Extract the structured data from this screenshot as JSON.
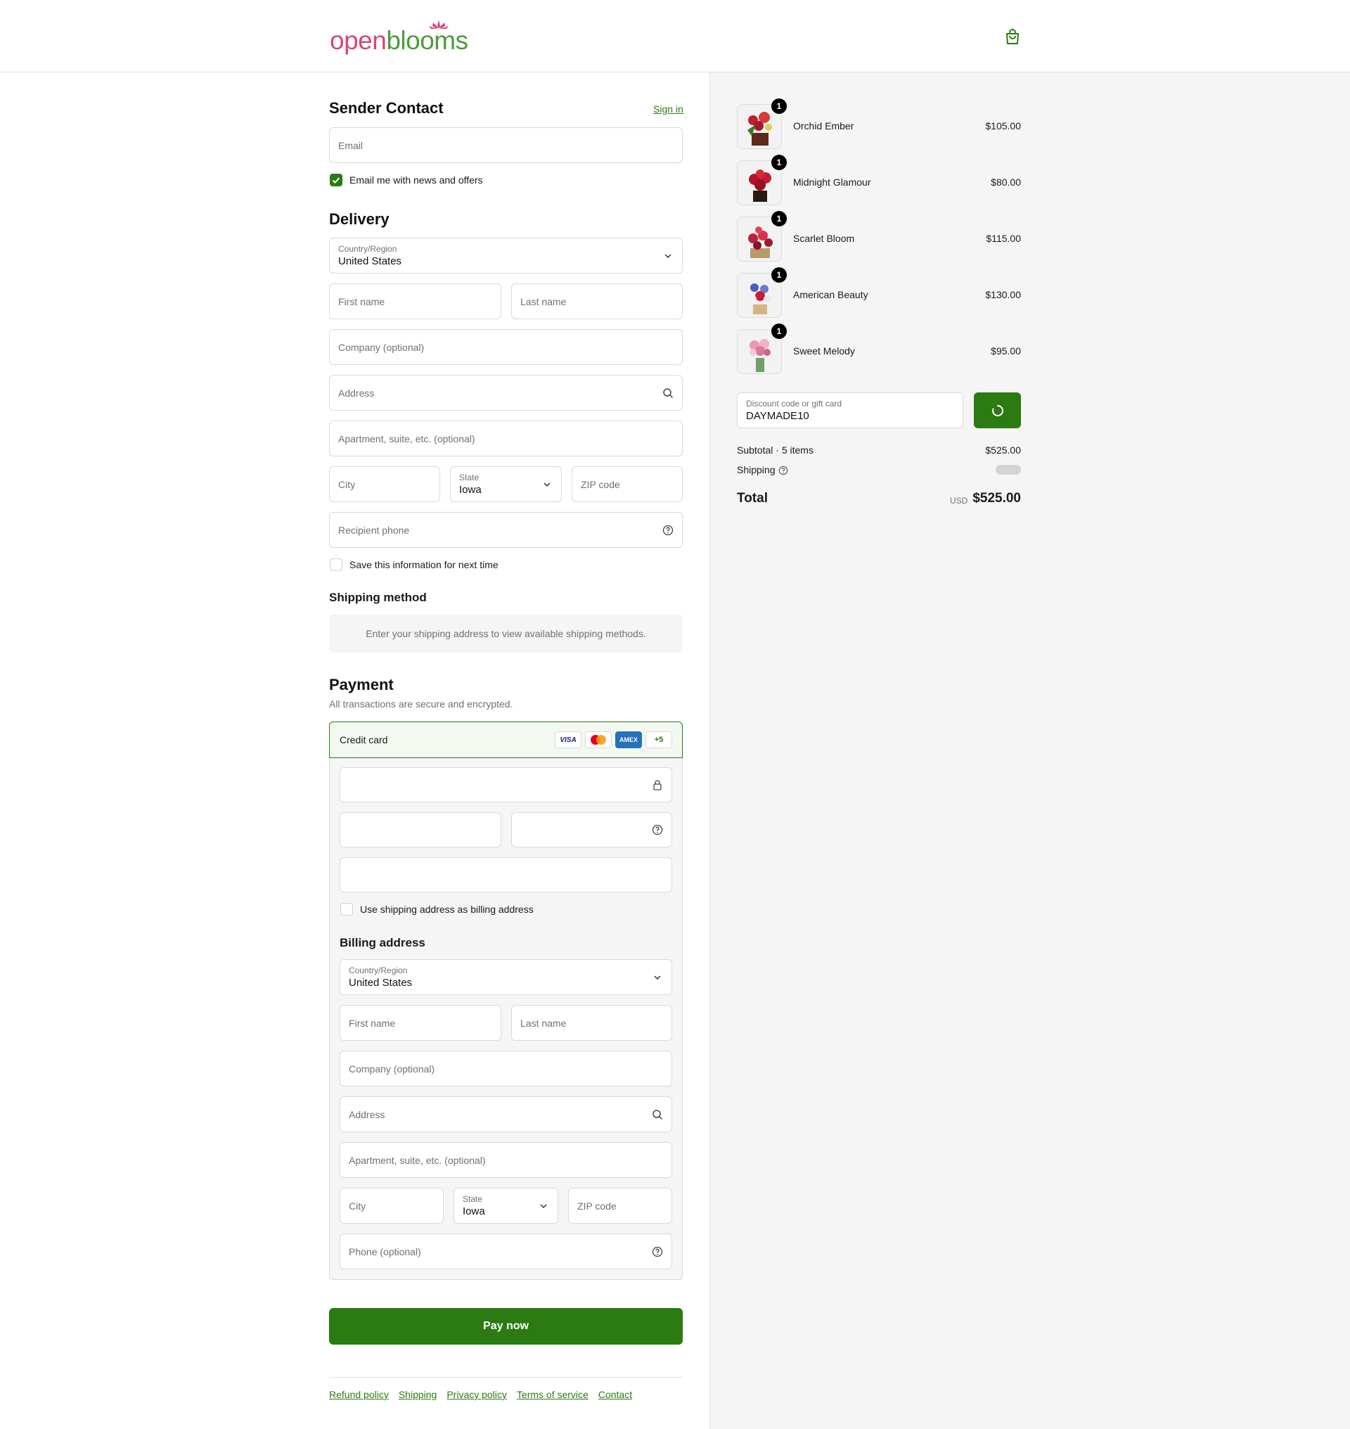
{
  "header": {
    "logo_open": "open",
    "logo_blooms": "blooms",
    "cart_icon": "shopping-bag-icon"
  },
  "contact": {
    "title": "Sender Contact",
    "sign_in": "Sign in",
    "email_placeholder": "Email",
    "news_label": "Email me with news and offers",
    "news_checked": true
  },
  "delivery": {
    "title": "Delivery",
    "country_label": "Country/Region",
    "country_value": "United States",
    "first_name": "First name",
    "last_name": "Last name",
    "company": "Company (optional)",
    "address": "Address",
    "apartment": "Apartment, suite, etc. (optional)",
    "city": "City",
    "state_label": "State",
    "state_value": "Iowa",
    "zip": "ZIP code",
    "phone": "Recipient phone",
    "save_label": "Save this information for next time",
    "save_checked": false
  },
  "shipping_method": {
    "title": "Shipping method",
    "message": "Enter your shipping address to view available shipping methods."
  },
  "payment": {
    "title": "Payment",
    "subtitle": "All transactions are secure and encrypted.",
    "method_label": "Credit card",
    "cards": [
      "VISA",
      "mastercard",
      "AMEX",
      "+5"
    ],
    "billing_same_label": "Use shipping address as billing address",
    "billing_same_checked": false,
    "billing_title": "Billing address",
    "billing": {
      "country_label": "Country/Region",
      "country_value": "United States",
      "first_name": "First name",
      "last_name": "Last name",
      "company": "Company (optional)",
      "address": "Address",
      "apartment": "Apartment, suite, etc. (optional)",
      "city": "City",
      "state_label": "State",
      "state_value": "Iowa",
      "zip": "ZIP code",
      "phone": "Phone (optional)"
    },
    "pay_button": "Pay now"
  },
  "footer": {
    "links": [
      "Refund policy",
      "Shipping",
      "Privacy policy",
      "Terms of service",
      "Contact"
    ]
  },
  "summary": {
    "items": [
      {
        "name": "Orchid Ember",
        "qty": "1",
        "price": "$105.00"
      },
      {
        "name": "Midnight Glamour",
        "qty": "1",
        "price": "$80.00"
      },
      {
        "name": "Scarlet Bloom",
        "qty": "1",
        "price": "$115.00"
      },
      {
        "name": "American Beauty",
        "qty": "1",
        "price": "$130.00"
      },
      {
        "name": "Sweet Melody",
        "qty": "1",
        "price": "$95.00"
      }
    ],
    "discount_label": "Discount code or gift card",
    "discount_value": "DAYMADE10",
    "subtotal_label": "Subtotal · 5 items",
    "subtotal_value": "$525.00",
    "shipping_label": "Shipping",
    "total_label": "Total",
    "currency": "USD",
    "total_value": "$525.00"
  },
  "colors": {
    "accent": "#2b7a12",
    "logo_pink": "#d6457a",
    "logo_green": "#4f9a3c"
  }
}
